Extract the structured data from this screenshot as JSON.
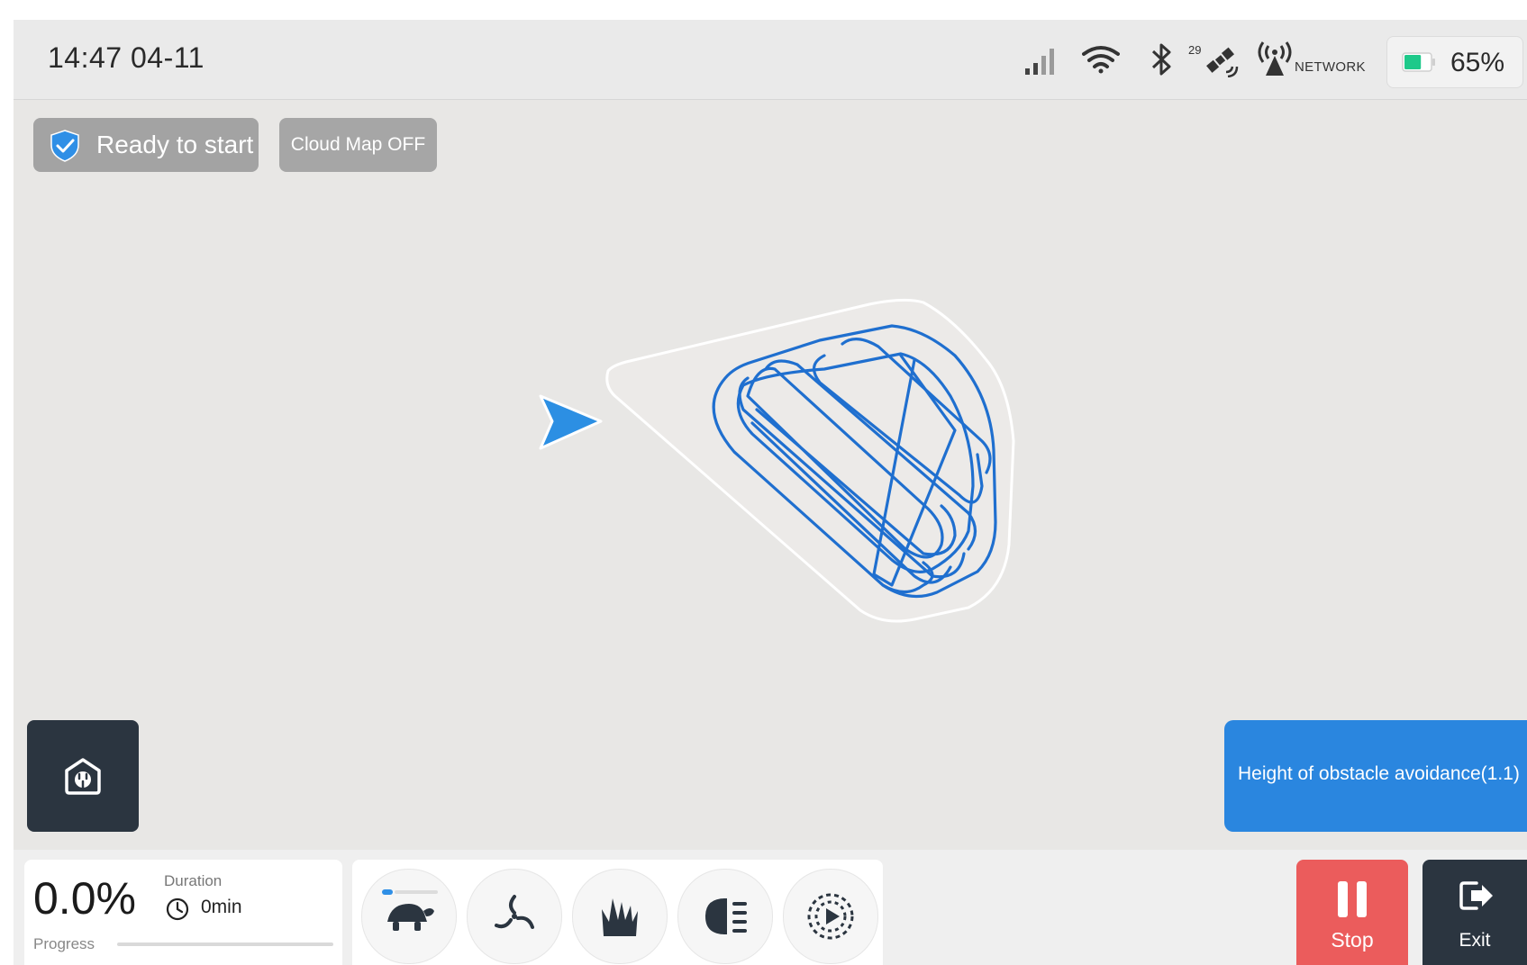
{
  "status_bar": {
    "time": "14:47 04-11",
    "satellite_count": "29",
    "network_label": "NETWORK",
    "battery_percent": "65%",
    "battery_level": 0.65,
    "icons": [
      "cellular-signal-icon",
      "wifi-icon",
      "bluetooth-icon",
      "satellite-icon",
      "network-antenna-icon",
      "battery-icon"
    ]
  },
  "chips": {
    "ready_label": "Ready to start",
    "cloud_map_label": "Cloud Map OFF"
  },
  "banner": {
    "obstacle_text": "Height of obstacle avoidance(1.1)"
  },
  "progress": {
    "percent_text": "0.0%",
    "percent_value": 0.0,
    "label": "Progress",
    "duration_label": "Duration",
    "duration_value": "0min"
  },
  "modes": [
    "turtle-speed-icon",
    "blade-icon",
    "grass-height-icon",
    "headlight-icon",
    "play-route-icon"
  ],
  "actions": {
    "stop_label": "Stop",
    "exit_label": "Exit"
  },
  "colors": {
    "accent_blue": "#2a86df",
    "stop_red": "#eb5c5c",
    "dark_button": "#2b3540",
    "battery_green": "#1ec98a",
    "path_blue": "#1f6fcf"
  }
}
